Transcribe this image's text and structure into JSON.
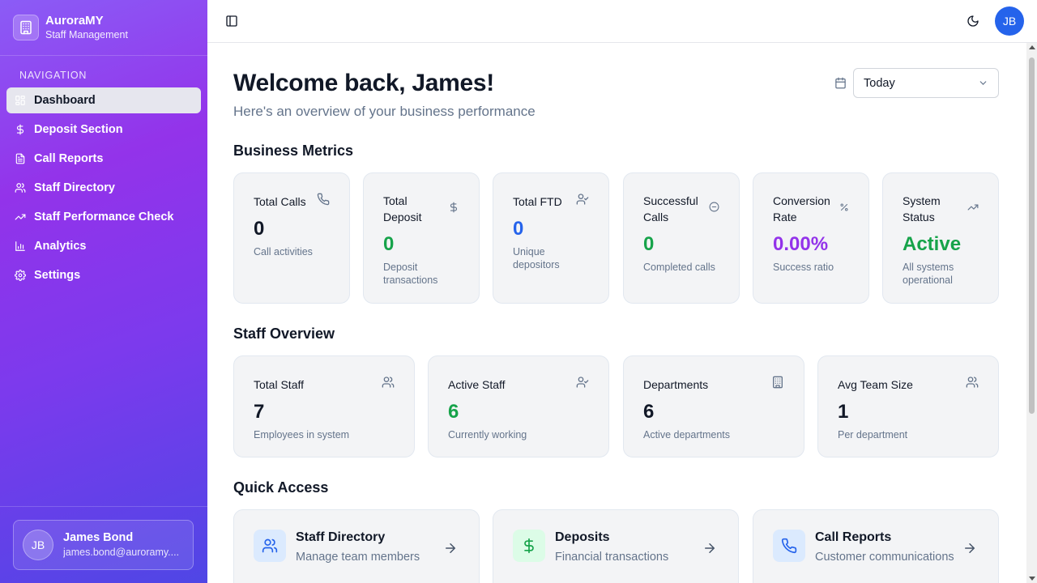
{
  "brand": {
    "title": "AuroraMY",
    "subtitle": "Staff Management"
  },
  "nav": {
    "label": "NAVIGATION",
    "items": [
      {
        "label": "Dashboard",
        "icon": "dashboard-icon",
        "active": true
      },
      {
        "label": "Deposit Section",
        "icon": "dollar-icon"
      },
      {
        "label": "Call Reports",
        "icon": "file-text-icon"
      },
      {
        "label": "Staff Directory",
        "icon": "users-icon"
      },
      {
        "label": "Staff Performance Check",
        "icon": "trending-up-icon"
      },
      {
        "label": "Analytics",
        "icon": "bar-chart-icon"
      },
      {
        "label": "Settings",
        "icon": "gear-icon"
      }
    ]
  },
  "user": {
    "initials": "JB",
    "name": "James Bond",
    "email": "james.bond@auroramy...."
  },
  "header": {
    "avatar": "JB"
  },
  "main": {
    "welcome": "Welcome back, James!",
    "subtitle": "Here's an overview of your business performance",
    "date_filter": "Today"
  },
  "sections": {
    "business": "Business Metrics",
    "staff": "Staff Overview",
    "quick": "Quick Access"
  },
  "metrics": [
    {
      "label": "Total Calls",
      "value": "0",
      "desc": "Call activities",
      "icon": "phone-icon",
      "color": "#111827"
    },
    {
      "label": "Total Deposit",
      "value": "0",
      "desc": "Deposit transactions",
      "icon": "dollar-icon",
      "color": "#16a34a"
    },
    {
      "label": "Total FTD",
      "value": "0",
      "desc": "Unique depositors",
      "icon": "user-check-icon",
      "color": "#2563eb"
    },
    {
      "label": "Successful Calls",
      "value": "0",
      "desc": "Completed calls",
      "icon": "check-circle-icon",
      "color": "#16a34a"
    },
    {
      "label": "Conversion Rate",
      "value": "0.00%",
      "desc": "Success ratio",
      "icon": "percent-icon",
      "color": "#9333ea"
    },
    {
      "label": "System Status",
      "value": "Active",
      "desc": "All systems operational",
      "icon": "trending-up-icon",
      "color": "#16a34a"
    }
  ],
  "staff": [
    {
      "label": "Total Staff",
      "value": "7",
      "desc": "Employees in system",
      "icon": "users-icon",
      "color": "#111827"
    },
    {
      "label": "Active Staff",
      "value": "6",
      "desc": "Currently working",
      "icon": "user-check-icon",
      "color": "#16a34a"
    },
    {
      "label": "Departments",
      "value": "6",
      "desc": "Active departments",
      "icon": "building-icon",
      "color": "#111827"
    },
    {
      "label": "Avg Team Size",
      "value": "1",
      "desc": "Per department",
      "icon": "users-icon",
      "color": "#111827"
    }
  ],
  "quick": [
    {
      "title": "Staff Directory",
      "desc": "Manage team members",
      "icon": "users-icon",
      "bg": "#dbeafe",
      "fg": "#2563eb"
    },
    {
      "title": "Deposits",
      "desc": "Financial transactions",
      "icon": "dollar-icon",
      "bg": "#dcfce7",
      "fg": "#16a34a"
    },
    {
      "title": "Call Reports",
      "desc": "Customer communications",
      "icon": "phone-icon",
      "bg": "#dbeafe",
      "fg": "#2563eb"
    }
  ]
}
